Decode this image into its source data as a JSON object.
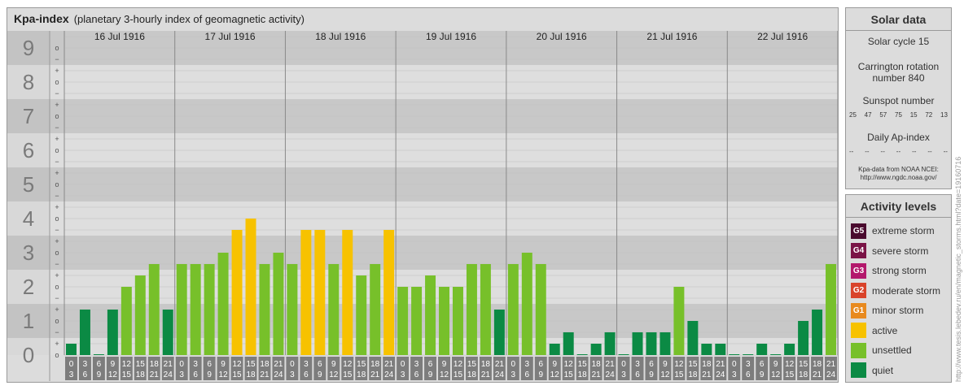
{
  "chart_data": {
    "type": "bar",
    "title": "Kpa-index",
    "subtitle": "(planetary 3-hourly index of geomagnetic activity)",
    "ylim": [
      0,
      9
    ],
    "y_tick_labels": [
      "0",
      "1",
      "2",
      "3",
      "4",
      "5",
      "6",
      "7",
      "8",
      "9"
    ],
    "y_minor_labels": [
      "+",
      "−",
      "o"
    ],
    "days": [
      "16 Jul 1916",
      "17 Jul 1916",
      "18 Jul 1916",
      "19 Jul 1916",
      "20 Jul 1916",
      "21 Jul 1916",
      "22 Jul 1916"
    ],
    "interval_top": [
      "0",
      "3",
      "6",
      "9",
      "12",
      "15",
      "18",
      "21"
    ],
    "interval_bottom": [
      "3",
      "6",
      "9",
      "12",
      "15",
      "18",
      "21",
      "24"
    ],
    "values": [
      0.333,
      1.333,
      0.0,
      1.333,
      2.0,
      2.333,
      2.667,
      1.333,
      2.667,
      2.667,
      2.667,
      3.0,
      3.667,
      4.0,
      2.667,
      3.0,
      2.667,
      3.667,
      3.667,
      2.667,
      3.667,
      2.333,
      2.667,
      3.667,
      2.0,
      2.0,
      2.333,
      2.0,
      2.0,
      2.667,
      2.667,
      1.333,
      2.667,
      3.0,
      2.667,
      0.333,
      0.667,
      0.0,
      0.333,
      0.667,
      0.0,
      0.667,
      0.667,
      0.667,
      2.0,
      1.0,
      0.333,
      0.333,
      0.0,
      0.0,
      0.333,
      0.0,
      0.333,
      1.0,
      1.333,
      2.667
    ],
    "levels": [
      "quiet",
      "quiet",
      "quiet",
      "quiet",
      "unsettled",
      "unsettled",
      "unsettled",
      "quiet",
      "unsettled",
      "unsettled",
      "unsettled",
      "unsettled",
      "active",
      "active",
      "unsettled",
      "unsettled",
      "unsettled",
      "active",
      "active",
      "unsettled",
      "active",
      "unsettled",
      "unsettled",
      "active",
      "unsettled",
      "unsettled",
      "unsettled",
      "unsettled",
      "unsettled",
      "unsettled",
      "unsettled",
      "quiet",
      "unsettled",
      "unsettled",
      "unsettled",
      "quiet",
      "quiet",
      "quiet",
      "quiet",
      "quiet",
      "quiet",
      "quiet",
      "quiet",
      "quiet",
      "unsettled",
      "quiet",
      "quiet",
      "quiet",
      "quiet",
      "quiet",
      "quiet",
      "quiet",
      "quiet",
      "quiet",
      "quiet",
      "unsettled"
    ],
    "level_colors": {
      "quiet": "#0b8a44",
      "unsettled": "#77c02a",
      "active": "#f7c200"
    },
    "grid": true
  },
  "solar": {
    "title": "Solar data",
    "cycle": "Solar cycle 15",
    "carrington_line1": "Carrington rotation",
    "carrington_line2": "number 840",
    "sunspot_title": "Sunspot number",
    "sunspot_values": [
      "25",
      "47",
      "57",
      "75",
      "15",
      "72",
      "13"
    ],
    "ap_title": "Daily Ap-index",
    "ap_values": [
      "--",
      "--",
      "--",
      "--",
      "--",
      "--",
      "--"
    ],
    "source_line1": "Kpa-data from NOAA NCEI:",
    "source_line2": "http://www.ngdc.noaa.gov/"
  },
  "activity": {
    "title": "Activity levels",
    "items": [
      {
        "badge": "G5",
        "label": "extreme storm",
        "color": "#4a0a2e"
      },
      {
        "badge": "G4",
        "label": "severe storm",
        "color": "#7a1446"
      },
      {
        "badge": "G3",
        "label": "strong storm",
        "color": "#b3186c"
      },
      {
        "badge": "G2",
        "label": "moderate storm",
        "color": "#d9432a"
      },
      {
        "badge": "G1",
        "label": "minor storm",
        "color": "#e88a1f"
      },
      {
        "badge": "",
        "label": "active",
        "color": "#f7c200"
      },
      {
        "badge": "",
        "label": "unsettled",
        "color": "#77c02a"
      },
      {
        "badge": "",
        "label": "quiet",
        "color": "#0b8a44"
      }
    ]
  },
  "watermark": "http://www.tesis.lebedev.ru/en/magnetic_storms.html?date=19160716"
}
